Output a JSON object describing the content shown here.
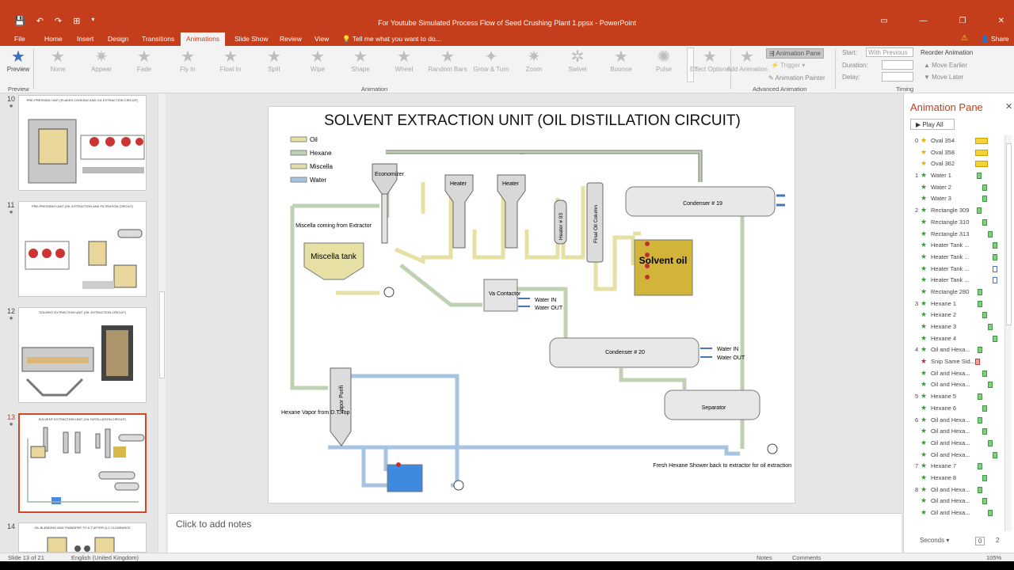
{
  "window": {
    "title": "For Youtube Simulated Process Flow of Seed Crushing Plant 1.ppsx - PowerPoint"
  },
  "menu": {
    "tabs": [
      "File",
      "Home",
      "Insert",
      "Design",
      "Transitions",
      "Animations",
      "Slide Show",
      "Review",
      "View"
    ],
    "tell": "Tell me what you want to do...",
    "share": "Share"
  },
  "ribbon": {
    "preview": "Preview",
    "effects": [
      "None",
      "Appear",
      "Fade",
      "Fly In",
      "Float In",
      "Split",
      "Wipe",
      "Shape",
      "Wheel",
      "Random Bars",
      "Grow & Turn",
      "Zoom",
      "Swivel",
      "Bounce",
      "Pulse"
    ],
    "effect_options": "Effect Options",
    "add_animation": "Add Animation",
    "animation_pane_btn": "Animation Pane",
    "trigger": "Trigger",
    "animation_painter": "Animation Painter",
    "start_label": "Start:",
    "start_value": "With Previous",
    "duration_label": "Duration:",
    "delay_label": "Delay:",
    "reorder": "Reorder Animation",
    "move_earlier": "Move Earlier",
    "move_later": "Move Later",
    "group_preview": "Preview",
    "group_animation": "Animation",
    "group_advanced": "Advanced Animation",
    "group_timing": "Timing"
  },
  "thumbs": [
    {
      "num": "10",
      "title": "PRE-PRESSING UNIT (FLAKES COOKING AND OIL EXTRACTION CIRCUIT)"
    },
    {
      "num": "11",
      "title": "PRE-PRESSING UNIT (OIL EXTRACTION AND FILTRATION CIRCUIT)"
    },
    {
      "num": "12",
      "title": "SOLVENT EXTRACTION UNIT (OIL EXTRACTION CIRCUIT)"
    },
    {
      "num": "13",
      "title": "SOLVENT EXTRACTION UNIT (OIL DISTILLATION CIRCUIT)"
    },
    {
      "num": "14",
      "title": "OIL BLENDING AND TRANSFER TO K.T AFTER Q.C CLEARANCE"
    }
  ],
  "slide": {
    "title": "SOLVENT EXTRACTION UNIT (OIL DISTILLATION CIRCUIT)",
    "legend": [
      "Oil",
      "Hexane",
      "Miscella",
      "Water"
    ],
    "labels": {
      "economizer": "Economizer",
      "heater1": "Heater",
      "heater2": "Heater",
      "heater3": "Heater # 03",
      "final_col": "Final Oil Column",
      "condenser19": "Condenser # 19",
      "condenser20": "Condenser # 20",
      "separator": "Separator",
      "miscella_tank": "Miscella tank",
      "miscella_coming": "Miscella coming from Extractor",
      "solvent_oil": "Solvent oil",
      "vac": "Va Contactor",
      "vapor_purifier": "Vapor Purifi",
      "water_in1": "Water IN",
      "water_out1": "Water OUT",
      "water_in2": "Water IN",
      "water_out2": "Water OUT",
      "hexane_vapor": "Hexane Vapor from D.T Top",
      "fresh_hexane": "Fresh Hexane Shower back to extractor for oil extraction"
    }
  },
  "notes": "Click to add notes",
  "animation_pane": {
    "title": "Animation Pane",
    "play_all": "Play All",
    "items": [
      {
        "n": "0",
        "name": "Oval 354",
        "kind": "y"
      },
      {
        "n": "",
        "name": "Oval 358",
        "kind": "y"
      },
      {
        "n": "",
        "name": "Oval 362",
        "kind": "y"
      },
      {
        "n": "1",
        "name": "Water 1",
        "kind": "g"
      },
      {
        "n": "",
        "name": "Water 2",
        "kind": "g"
      },
      {
        "n": "",
        "name": "Water 3",
        "kind": "g"
      },
      {
        "n": "2",
        "name": "Rectangle 309",
        "kind": "g"
      },
      {
        "n": "",
        "name": "Rectangle 310",
        "kind": "g"
      },
      {
        "n": "",
        "name": "Rectangle 313",
        "kind": "g"
      },
      {
        "n": "",
        "name": "Heater Tank ...",
        "kind": "g"
      },
      {
        "n": "",
        "name": "Heater Tank ...",
        "kind": "g"
      },
      {
        "n": "",
        "name": "Heater Tank ...",
        "kind": "t"
      },
      {
        "n": "",
        "name": "Heater Tank ...",
        "kind": "t"
      },
      {
        "n": "",
        "name": "Rectangle 280",
        "kind": "g"
      },
      {
        "n": "3",
        "name": "Hexane 1",
        "kind": "g"
      },
      {
        "n": "",
        "name": "Hexane 2",
        "kind": "g"
      },
      {
        "n": "",
        "name": "Hexane 3",
        "kind": "g"
      },
      {
        "n": "",
        "name": "Hexane 4",
        "kind": "g"
      },
      {
        "n": "4",
        "name": "Oil and Hexa...",
        "kind": "g"
      },
      {
        "n": "",
        "name": "Snip Same Sid...",
        "kind": "r"
      },
      {
        "n": "",
        "name": "Oil and Hexa...",
        "kind": "g"
      },
      {
        "n": "",
        "name": "Oil and Hexa...",
        "kind": "g"
      },
      {
        "n": "5",
        "name": "Hexane 5",
        "kind": "g"
      },
      {
        "n": "",
        "name": "Hexane 6",
        "kind": "g"
      },
      {
        "n": "6",
        "name": "Oil and Hexa...",
        "kind": "g"
      },
      {
        "n": "",
        "name": "Oil and Hexa...",
        "kind": "g"
      },
      {
        "n": "",
        "name": "Oil and Hexa...",
        "kind": "g"
      },
      {
        "n": "",
        "name": "Oil and Hexa...",
        "kind": "g"
      },
      {
        "n": "7",
        "name": "Hexane 7",
        "kind": "g"
      },
      {
        "n": "",
        "name": "Hexane 8",
        "kind": "g"
      },
      {
        "n": "8",
        "name": "Oil and Hexa...",
        "kind": "g"
      },
      {
        "n": "",
        "name": "Oil and Hexa...",
        "kind": "g"
      },
      {
        "n": "",
        "name": "Oil and Hexa...",
        "kind": "g"
      }
    ],
    "seconds": "Seconds",
    "sec0": "0",
    "sec2": "2"
  },
  "status": {
    "slide": "Slide 13 of 21",
    "lang": "English (United Kingdom)",
    "notes": "Notes",
    "comments": "Comments",
    "zoom": "105%"
  }
}
